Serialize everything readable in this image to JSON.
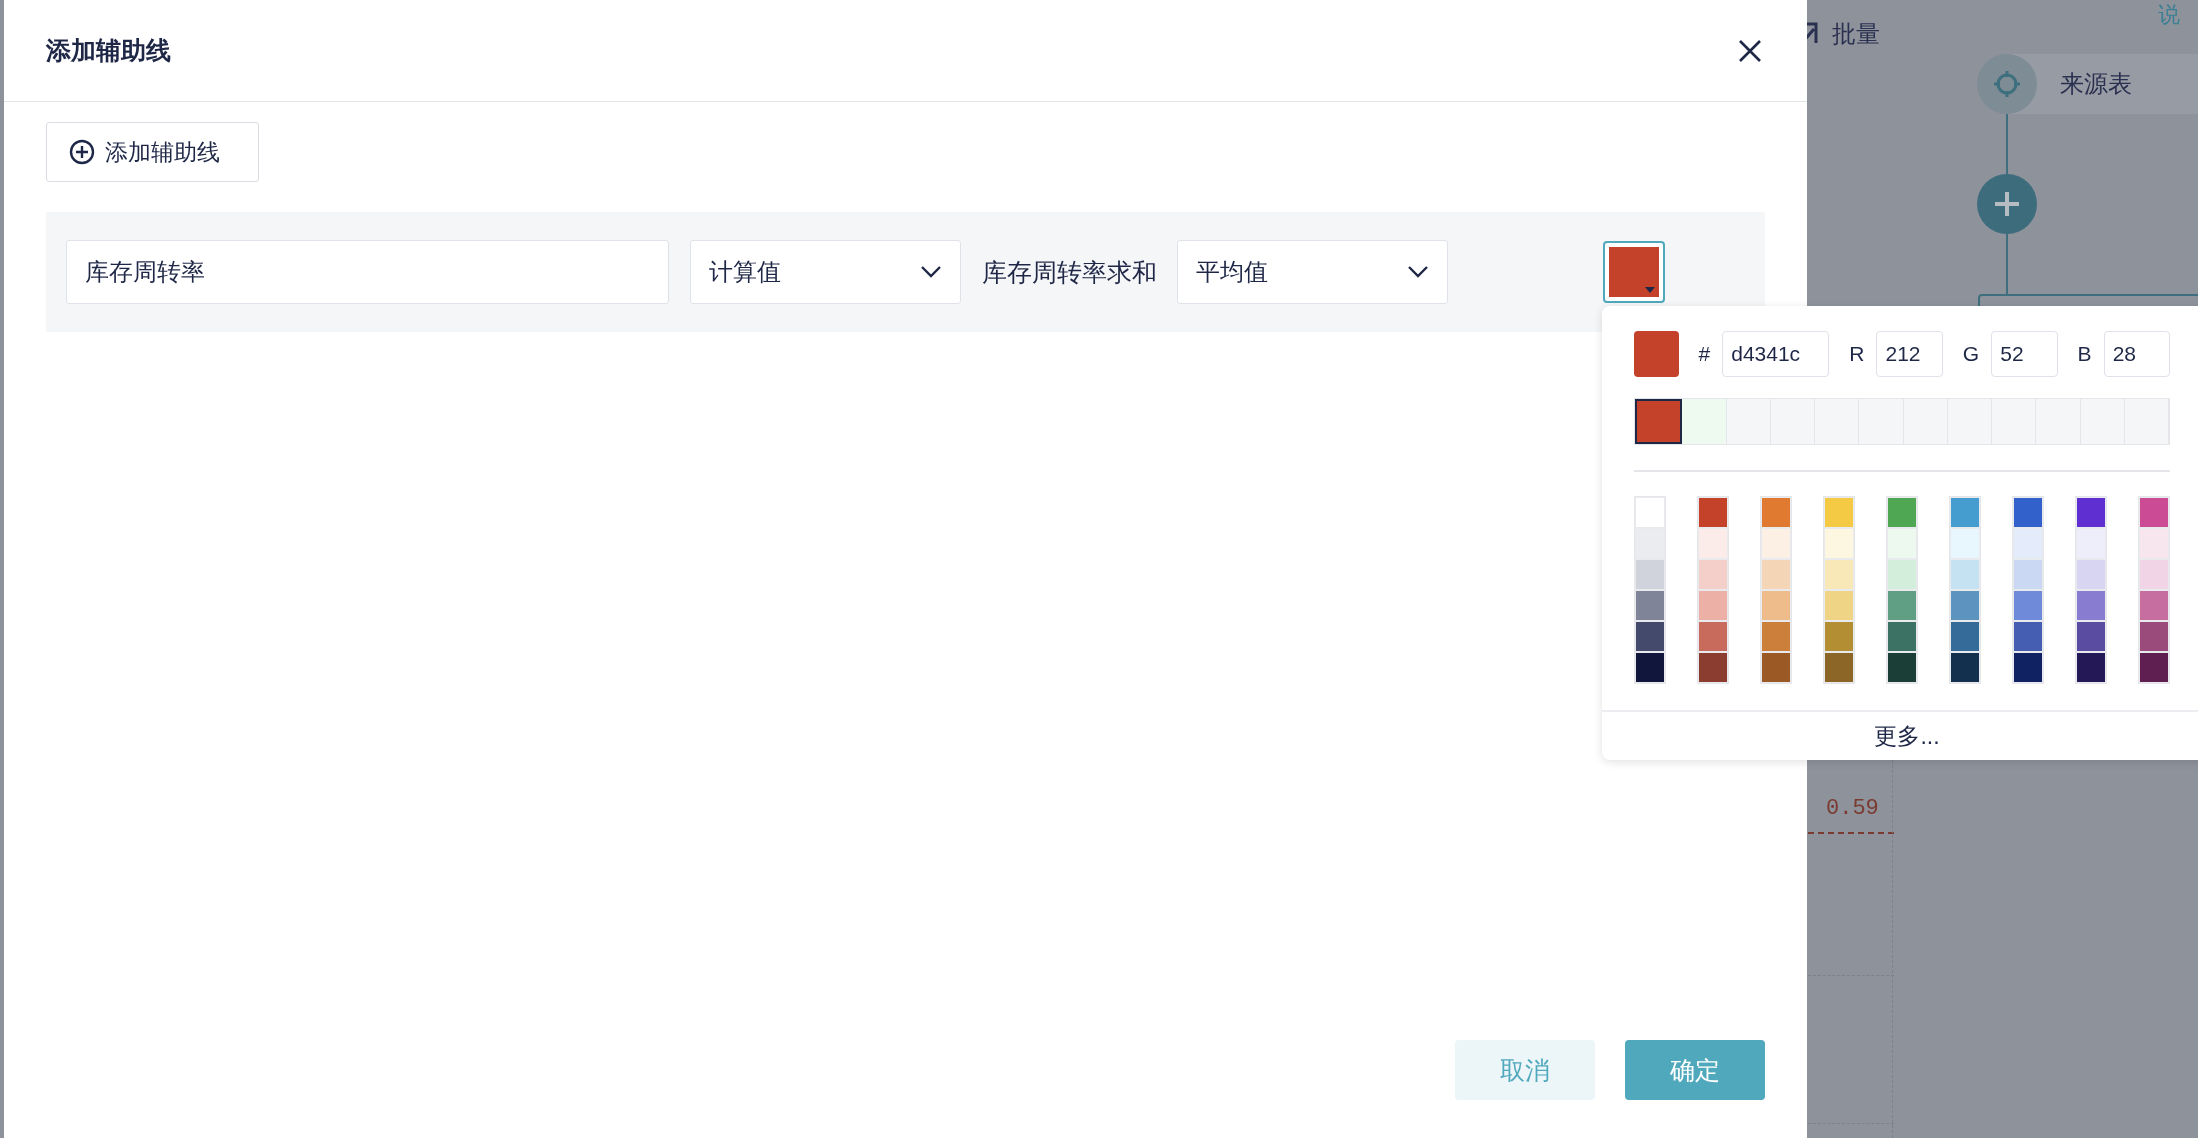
{
  "background": {
    "batch_button": "批量",
    "help_link": "说",
    "flow": {
      "source_node": "来源表"
    },
    "chart_label": "0.59"
  },
  "dialog": {
    "title": "添加辅助线",
    "add_button": "添加辅助线",
    "line": {
      "name": "库存周转率",
      "type_select": "计算值",
      "field_label": "库存周转率求和",
      "agg_select": "平均值",
      "color": "#c4412a"
    },
    "buttons": {
      "cancel": "取消",
      "ok": "确定"
    }
  },
  "color_picker": {
    "current": {
      "color": "#c4412a"
    },
    "hash": "#",
    "hex": "d4341c",
    "r_label": "R",
    "r": "212",
    "g_label": "G",
    "g": "52",
    "b_label": "B",
    "b": "28",
    "recent": [
      {
        "kind": "color",
        "color": "#c4412a",
        "selected": true
      },
      {
        "kind": "color",
        "color": "#eefaf0",
        "selected": false
      },
      {
        "kind": "empty",
        "selected": false
      },
      {
        "kind": "empty",
        "selected": false
      },
      {
        "kind": "empty",
        "selected": false
      },
      {
        "kind": "empty",
        "selected": false
      },
      {
        "kind": "empty",
        "selected": false
      },
      {
        "kind": "empty",
        "selected": false
      },
      {
        "kind": "empty",
        "selected": false
      },
      {
        "kind": "empty",
        "selected": false
      },
      {
        "kind": "empty",
        "selected": false
      },
      {
        "kind": "empty",
        "selected": false
      }
    ],
    "palette": [
      {
        "swatches": [
          {
            "color": "#ffffff"
          },
          {
            "color": "#ebecf0"
          },
          {
            "color": "#d0d3db"
          },
          {
            "color": "#808499"
          },
          {
            "color": "#434a6b"
          },
          {
            "color": "#11163d"
          }
        ]
      },
      {
        "swatches": [
          {
            "color": "#c4412a"
          },
          {
            "color": "#fbecea"
          },
          {
            "color": "#f4cec8"
          },
          {
            "color": "#ecb0a6"
          },
          {
            "color": "#c86b5d"
          },
          {
            "color": "#8b3e30"
          }
        ]
      },
      {
        "swatches": [
          {
            "color": "#df7a30"
          },
          {
            "color": "#fcf0e5"
          },
          {
            "color": "#f4d6b7"
          },
          {
            "color": "#edbc8a"
          },
          {
            "color": "#cb7f3a"
          },
          {
            "color": "#9b5a25"
          }
        ]
      },
      {
        "swatches": [
          {
            "color": "#f4c944"
          },
          {
            "color": "#fdf7e2"
          },
          {
            "color": "#f8e7b7"
          },
          {
            "color": "#efd486"
          },
          {
            "color": "#b38e32"
          },
          {
            "color": "#8b6627"
          }
        ]
      },
      {
        "swatches": [
          {
            "color": "#4fa653"
          },
          {
            "color": "#edf9ef"
          },
          {
            "color": "#d3eedb"
          },
          {
            "color": "#609f83"
          },
          {
            "color": "#3b7263"
          },
          {
            "color": "#1b3f37"
          }
        ]
      },
      {
        "swatches": [
          {
            "color": "#459ccf"
          },
          {
            "color": "#e8f6fd"
          },
          {
            "color": "#c5e2f3"
          },
          {
            "color": "#5d94bf"
          },
          {
            "color": "#356b98"
          },
          {
            "color": "#13304f"
          }
        ]
      },
      {
        "swatches": [
          {
            "color": "#3261cc"
          },
          {
            "color": "#e4ecfb"
          },
          {
            "color": "#cbd8f4"
          },
          {
            "color": "#6f8ad8"
          },
          {
            "color": "#465eb2"
          },
          {
            "color": "#112263"
          }
        ]
      },
      {
        "swatches": [
          {
            "color": "#5f2fd2"
          },
          {
            "color": "#eeeefb"
          },
          {
            "color": "#d7d5f2"
          },
          {
            "color": "#877ccf"
          },
          {
            "color": "#5a4ca0"
          },
          {
            "color": "#241856"
          }
        ]
      },
      {
        "swatches": [
          {
            "color": "#cc4b95"
          },
          {
            "color": "#f8e6ef"
          },
          {
            "color": "#f1d5e6"
          },
          {
            "color": "#c66e9f"
          },
          {
            "color": "#9b4a7c"
          },
          {
            "color": "#5f1f51"
          }
        ]
      }
    ],
    "more": "更多..."
  }
}
